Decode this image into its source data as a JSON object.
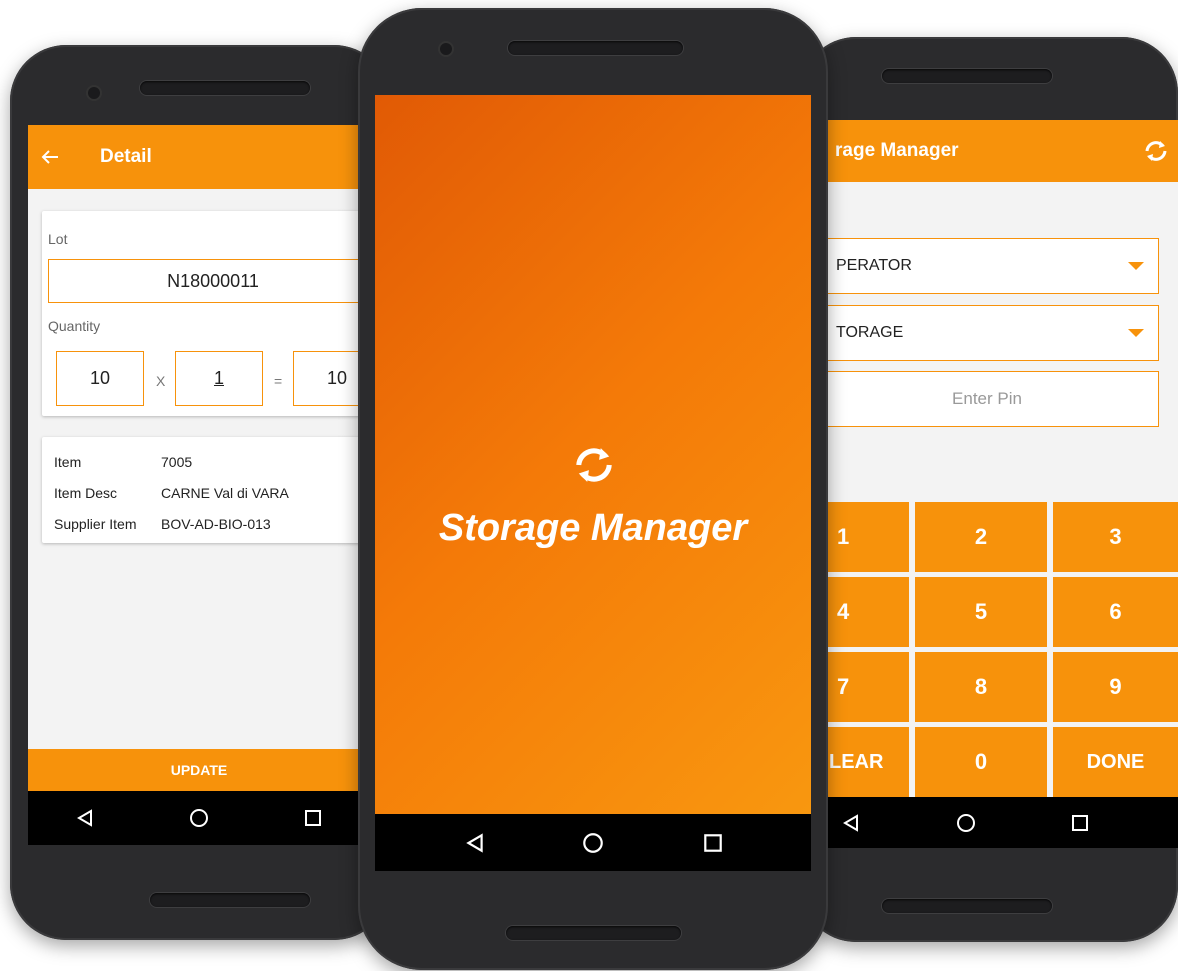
{
  "detail": {
    "title": "Detail",
    "lot_label": "Lot",
    "lot_value": "N18000011",
    "quantity_label": "Quantity",
    "qty_a": "10",
    "qty_op_mul": "X",
    "qty_b": "1",
    "qty_op_eq": "=",
    "qty_total": "10",
    "info": [
      {
        "key": "Item",
        "value": "7005"
      },
      {
        "key": "Item Desc",
        "value": "CARNE Val di VARA"
      },
      {
        "key": "Supplier Item",
        "value": "BOV-AD-BIO-013"
      }
    ],
    "update_label": "UPDATE"
  },
  "splash": {
    "title": "Storage Manager"
  },
  "login": {
    "title": "rage Manager",
    "operator_value": "PERATOR",
    "storage_value": "TORAGE",
    "pin_placeholder": "Enter Pin",
    "keys": [
      "1",
      "2",
      "3",
      "4",
      "5",
      "6",
      "7",
      "8",
      "9",
      "LEAR",
      "0",
      "DONE"
    ]
  },
  "colors": {
    "accent": "#f7920b",
    "splash_start": "#e15a05",
    "splash_end": "#f99a10"
  },
  "icons": [
    "back-arrow-icon",
    "sync-icon",
    "nav-back-icon",
    "nav-home-icon",
    "nav-recents-icon",
    "dropdown-caret-icon"
  ]
}
